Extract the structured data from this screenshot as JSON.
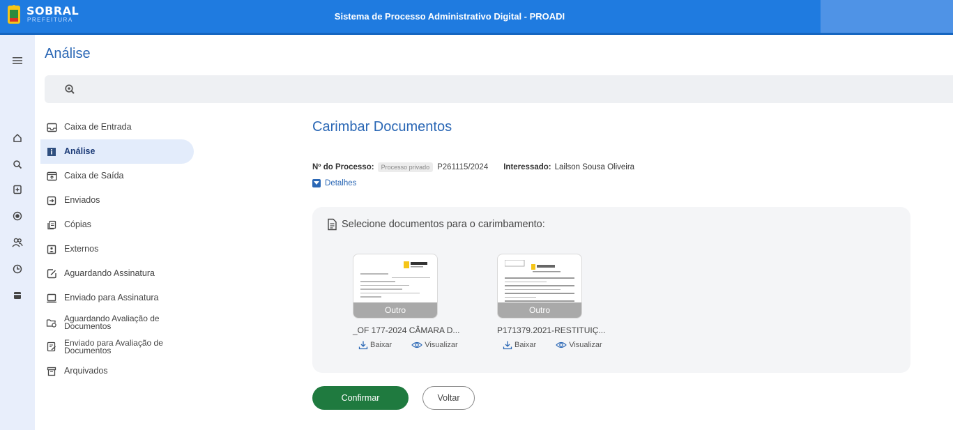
{
  "header": {
    "logo_text": "SOBRAL",
    "logo_subtext": "PREFEITURA",
    "app_title": "Sistema de Processo Administrativo Digital - PROADI"
  },
  "page": {
    "title": "Análise"
  },
  "search": {
    "icon": "zoom-icon"
  },
  "rail": {
    "icons": [
      "menu-icon",
      "home-icon",
      "search-icon",
      "plus-document-icon",
      "circle-dot-icon",
      "users-icon",
      "history-icon",
      "archive-icon"
    ]
  },
  "menu": {
    "items": [
      {
        "label": "Caixa de Entrada",
        "icon": "inbox-icon"
      },
      {
        "label": "Análise",
        "icon": "info-icon"
      },
      {
        "label": "Caixa de Saída",
        "icon": "outbox-icon"
      },
      {
        "label": "Enviados",
        "icon": "sent-icon"
      },
      {
        "label": "Cópias",
        "icon": "copies-icon"
      },
      {
        "label": "Externos",
        "icon": "external-icon"
      },
      {
        "label": "Aguardando Assinatura",
        "icon": "pending-signature-icon"
      },
      {
        "label": "Enviado para Assinatura",
        "icon": "sent-signature-icon"
      },
      {
        "label": "Aguardando Avaliação de Documentos",
        "icon": "folder-pending-icon"
      },
      {
        "label": "Enviado para Avaliação de Documentos",
        "icon": "document-evaluation-icon"
      },
      {
        "label": "Arquivados",
        "icon": "archived-icon"
      }
    ]
  },
  "main": {
    "title": "Carimbar Documentos",
    "process_label": "Nº do Processo:",
    "process_badge": "Processo privado",
    "process_number": "P261115/2024",
    "interested_label": "Interessado:",
    "interested_name": "Lailson Sousa Oliveira",
    "details_label": "Detalhes",
    "docs_heading": "Selecione documentos para o carimbamento:",
    "documents": [
      {
        "name": "_OF 177-2024 CÂMARA D...",
        "type": "Outro",
        "download": "Baixar",
        "view": "Visualizar"
      },
      {
        "name": "P171379.2021-RESTITUIÇ...",
        "type": "Outro",
        "download": "Baixar",
        "view": "Visualizar"
      }
    ],
    "confirm_label": "Confirmar",
    "back_label": "Voltar"
  },
  "colors": {
    "topbar": "#1f7be0",
    "accent": "#2a67b5",
    "confirm": "#1f7a3f"
  }
}
